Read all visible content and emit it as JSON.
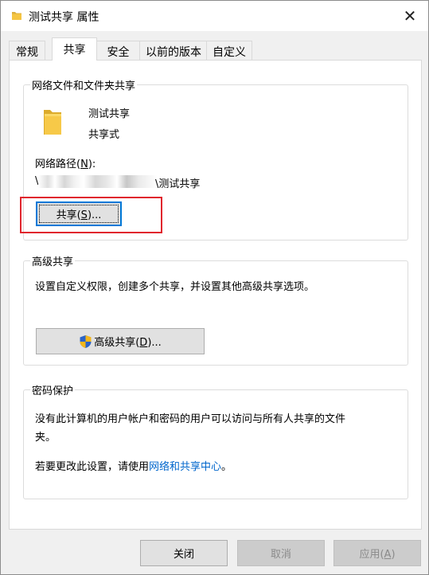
{
  "window": {
    "title": "测试共享 属性",
    "close_glyph": "✕"
  },
  "tabs": [
    {
      "label": "常规"
    },
    {
      "label": "共享"
    },
    {
      "label": "安全"
    },
    {
      "label": "以前的版本"
    },
    {
      "label": "自定义"
    }
  ],
  "active_tab": "共享",
  "network_sharing": {
    "group_title": "网络文件和文件夹共享",
    "folder_name": "测试共享",
    "folder_status": "共享式",
    "path_label_prefix": "网络路径(",
    "path_label_accel": "N",
    "path_label_suffix": "):",
    "path_prefix": "\\",
    "path_suffix": "\\测试共享",
    "share_button_prefix": "共享(",
    "share_button_accel": "S",
    "share_button_suffix": ")..."
  },
  "advanced_sharing": {
    "group_title": "高级共享",
    "description": "设置自定义权限，创建多个共享，并设置其他高级共享选项。",
    "button_prefix": "高级共享(",
    "button_accel": "D",
    "button_suffix": ")...",
    "button_icon": "uac-shield-icon"
  },
  "password_protection": {
    "group_title": "密码保护",
    "description_line1": "没有此计算机的用户帐户和密码的用户可以访问与所有人共享的文件",
    "description_line2": "夹。",
    "change_prefix": "若要更改此设置，请使用",
    "change_link": "网络和共享中心",
    "change_suffix": "。"
  },
  "footer": {
    "close_label": "关闭",
    "cancel_label": "取消",
    "apply_prefix": "应用(",
    "apply_accel": "A",
    "apply_suffix": ")"
  },
  "colors": {
    "highlight_box": "#e0252d",
    "link": "#0066cc",
    "focus_border": "#0078d7",
    "folder": "#f5c542"
  }
}
